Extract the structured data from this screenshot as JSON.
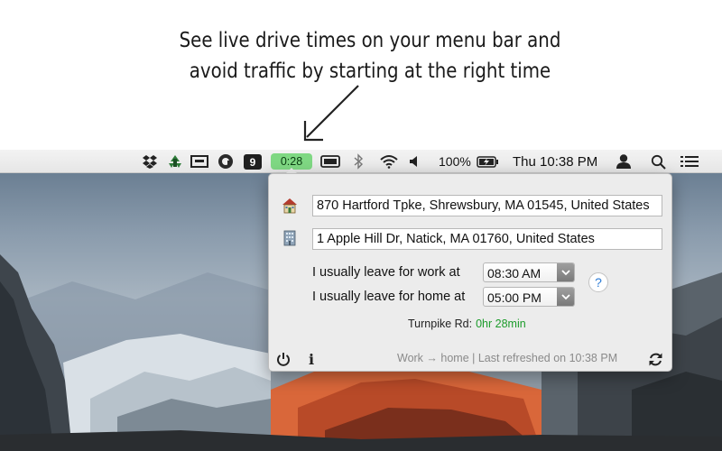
{
  "headline": {
    "line1": "See live drive times on your menu bar and",
    "line2": "avoid traffic by starting at the right time"
  },
  "menubar": {
    "icons": [
      "dropbox-icon",
      "recycle-icon",
      "menu-box-icon",
      "circle-a-icon",
      "badge-9",
      "drive-time",
      "keyboard-icon",
      "bluetooth-icon",
      "wifi-icon",
      "volume-icon",
      "battery",
      "clock",
      "user-icon",
      "search-icon",
      "list-icon"
    ],
    "badge_9": "9",
    "drive_time": "0:28",
    "battery_percent": "100%",
    "clock": "Thu 10:38 PM",
    "accent": "#7fd883"
  },
  "panel": {
    "home_address": "870 Hartford Tpke, Shrewsbury, MA  01545, United States",
    "work_address": "1 Apple Hill Dr, Natick, MA  01760, United States",
    "leave_work_label": "I usually leave for work at",
    "leave_work_time": "08:30 AM",
    "leave_home_label": "I usually leave for home at",
    "leave_home_time": "05:00 PM",
    "help_label": "?",
    "route_label": "Turnpike Rd:",
    "route_time": "0hr 28min",
    "route_color": "#1c9c2b",
    "footer_status": "Work → home  |  Last refreshed on 10:38 PM",
    "info_label": "i"
  }
}
